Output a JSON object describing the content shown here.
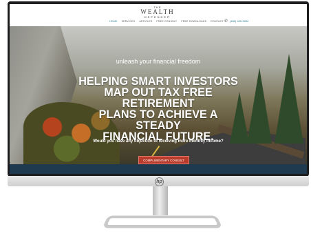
{
  "site": {
    "brand": {
      "the": "THE",
      "name": "WEALTH",
      "sub": "DEFENDER"
    },
    "nav": [
      "HOME",
      "SERVICES",
      "ARTICLES",
      "FREE CONSULT",
      "FREE DOWNLOADS",
      "CONTACT"
    ],
    "phone": "(480) 420-9092"
  },
  "hero": {
    "tagline": "unleash your financial freedom",
    "headline_lines": [
      "HELPING SMART INVESTORS",
      "MAP OUT TAX FREE RETIREMENT",
      "PLANS TO ACHIEVE A STEADY",
      "FINANCIAL FUTURE."
    ],
    "question": "Would you have any objection to receiving more monthly income?",
    "cta_label": "COMPLIMENTARY CONSULT"
  },
  "monitor": {
    "logo": "hp"
  },
  "colors": {
    "accent": "#2a7a8c",
    "cta": "#b83b2c",
    "band": "#1f3a4f"
  }
}
